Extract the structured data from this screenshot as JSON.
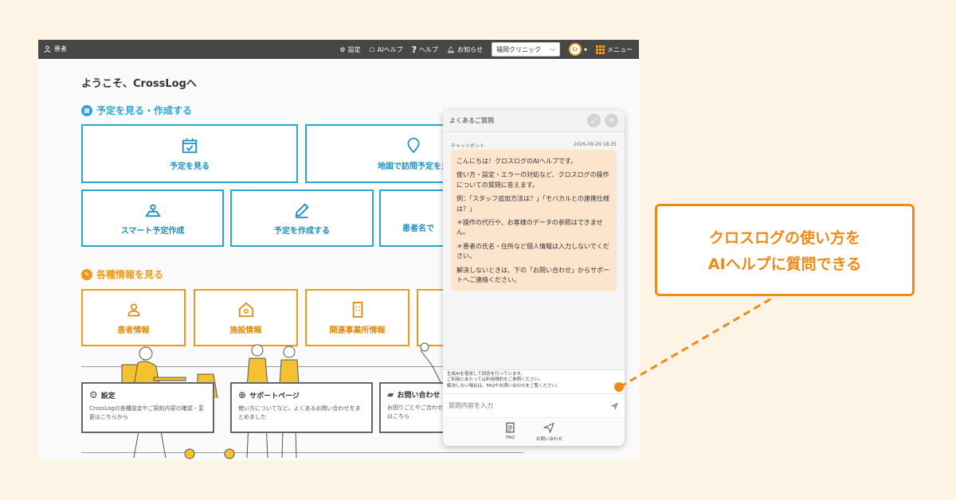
{
  "topbar": {
    "user_label": "患者",
    "settings": "設定",
    "ai_help": "AIヘルプ",
    "help": "ヘルプ",
    "notifications": "お知らせ",
    "clinic_select": "福岡クリニック",
    "avatar": "Cr",
    "menu": "メニュー"
  },
  "main": {
    "welcome": "ようこそ、CrossLogへ",
    "section_schedule": "予定を見る・作成する",
    "section_info": "各種情報を見る",
    "cards": {
      "view_schedule": "予定を見る",
      "map_visit": "地図で訪問予定を見",
      "smart_create": "スマート予定作成",
      "create_schedule": "予定を作成する",
      "patient_search": "患者名で",
      "patient_info": "患者情報",
      "facility_info": "施設情報",
      "related_office": "関連事業所情報"
    },
    "info_cards": {
      "settings_title": "設定",
      "settings_desc": "CrossLogの各種設定やご契約内容の確認・変更はこちらから",
      "support_title": "サポートページ",
      "support_desc": "使い方についてなど、よくあるお問い合わせをまとめました",
      "contact_title": "お問い合わせ",
      "contact_desc": "お困りごとやご合わせはこちら"
    }
  },
  "chat": {
    "header": "よくあるご質問",
    "sender": "チャットボット",
    "timestamp": "2026-09-29 18:35",
    "messages": [
      "こんにちは！クロスログのAIヘルプです。",
      "使い方・設定・エラーの対処など、クロスログの操作についての質問に答えます。",
      "例：「スタッフ追加方法は？」「モバカルとの連携仕様は？」",
      "＊操作の代行や、お客様のデータの参照はできません。",
      "＊患者の氏名・住所など個人情報は入力しないでください。",
      "解決しないときは、下の「お問い合わせ」からサポートへご連絡ください。"
    ],
    "disclaimer_1": "生成AIを使用して回答を行っています。",
    "disclaimer_2": "ご利用にあたっては利用規約をご参照ください。",
    "disclaimer_3": "解決しない場合は、FAQやお問い合わせをご覧ください。",
    "input_placeholder": "質問内容を入力",
    "footer_faq": "FAQ",
    "footer_contact": "お問い合わせ"
  },
  "callout": {
    "line1": "クロスログの使い方を",
    "line2": "AIヘルプに質問できる"
  },
  "colors": {
    "accent_blue": "#2aa6d6",
    "accent_orange": "#ef9a16",
    "callout_orange": "#ef8a16",
    "bubble": "#fde4cc",
    "topbar": "#474747"
  }
}
